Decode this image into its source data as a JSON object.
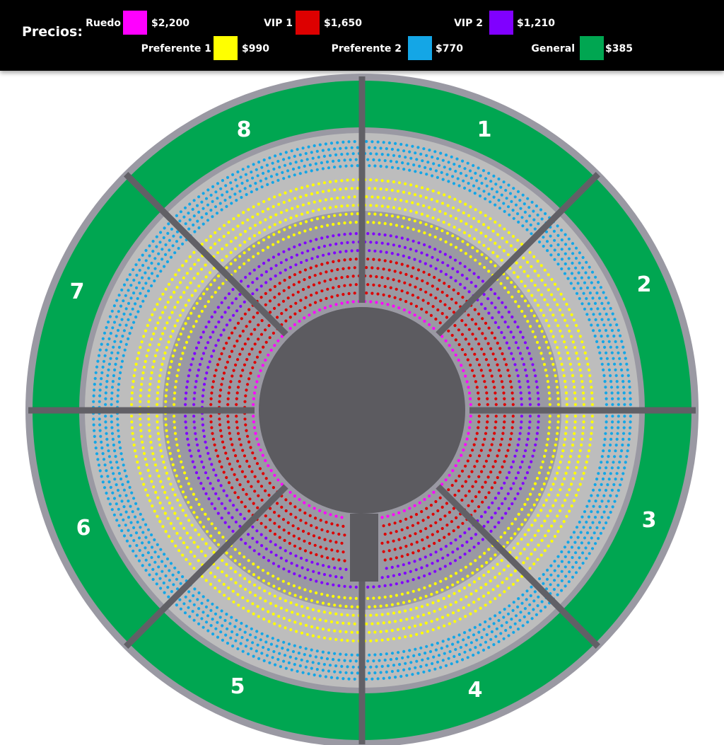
{
  "legend": {
    "title": "Precios:",
    "items": [
      {
        "name": "Ruedo",
        "price": "$2,200",
        "color": "#ff00ff"
      },
      {
        "name": "VIP 1",
        "price": "$1,650",
        "color": "#dd0000"
      },
      {
        "name": "VIP 2",
        "price": "$1,210",
        "color": "#8000ff"
      },
      {
        "name": "Preferente 1",
        "price": "$990",
        "color": "#ffff00"
      },
      {
        "name": "Preferente 2",
        "price": "$770",
        "color": "#14a6e6"
      },
      {
        "name": "General",
        "price": "$385",
        "color": "#00a651"
      }
    ]
  },
  "sections": [
    "1",
    "2",
    "3",
    "4",
    "5",
    "6",
    "7",
    "8"
  ],
  "colors": {
    "outer_ring": "#9a99a3",
    "general": "#00a651",
    "concourse": "#bdbdbd",
    "aisle": "#616066",
    "stage": "#5c5b60",
    "ruedo": "#ff00ff",
    "vip1": "#dd0000",
    "vip2": "#8000ff",
    "preferente1": "#ffff00",
    "preferente2": "#14a6e6"
  }
}
